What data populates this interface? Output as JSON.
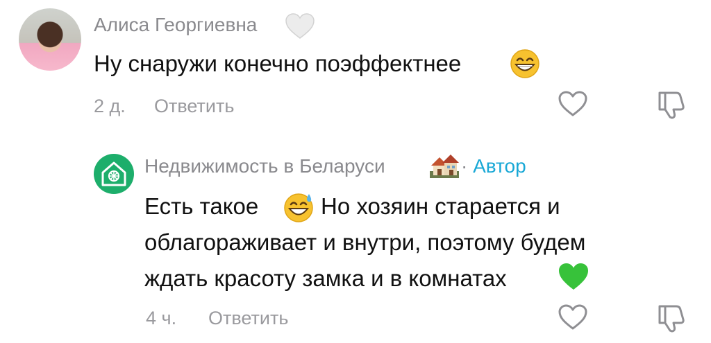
{
  "comment1": {
    "author": "Алиса Георгиевна",
    "text": "Ну снаружи конечно поэффектнее",
    "time": "2 д.",
    "reply_label": "Ответить"
  },
  "comment2": {
    "author": "Недвижимость в Беларуси",
    "separator": "·",
    "author_badge": "Автор",
    "text_lines": [
      "Есть такое",
      "Но хозяин старается и",
      "облагораживает и внутри, поэтому будем",
      "ждать красоту замка и в комнатах"
    ],
    "time": "4 ч.",
    "reply_label": "Ответить"
  },
  "colors": {
    "accent_author": "#19a8d6",
    "brand_green": "#1dae6b",
    "meta_gray": "#9a9a9e"
  },
  "icons": {
    "like": "heart-outline-icon",
    "dislike": "thumbs-down-outline-icon",
    "badge": "white-heart-icon"
  }
}
